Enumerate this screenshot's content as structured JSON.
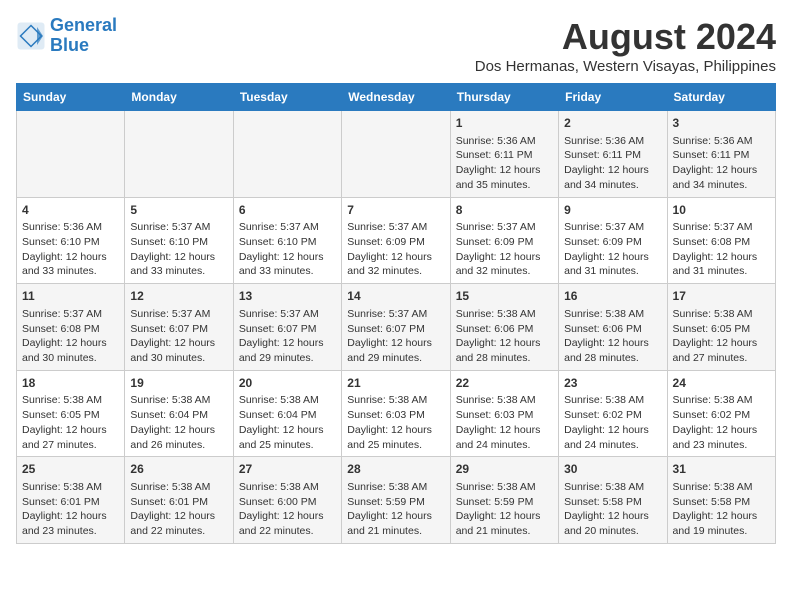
{
  "logo": {
    "line1": "General",
    "line2": "Blue"
  },
  "title": "August 2024",
  "subtitle": "Dos Hermanas, Western Visayas, Philippines",
  "days_header": [
    "Sunday",
    "Monday",
    "Tuesday",
    "Wednesday",
    "Thursday",
    "Friday",
    "Saturday"
  ],
  "weeks": [
    [
      {
        "day": "",
        "content": ""
      },
      {
        "day": "",
        "content": ""
      },
      {
        "day": "",
        "content": ""
      },
      {
        "day": "",
        "content": ""
      },
      {
        "day": "1",
        "content": "Sunrise: 5:36 AM\nSunset: 6:11 PM\nDaylight: 12 hours\nand 35 minutes."
      },
      {
        "day": "2",
        "content": "Sunrise: 5:36 AM\nSunset: 6:11 PM\nDaylight: 12 hours\nand 34 minutes."
      },
      {
        "day": "3",
        "content": "Sunrise: 5:36 AM\nSunset: 6:11 PM\nDaylight: 12 hours\nand 34 minutes."
      }
    ],
    [
      {
        "day": "4",
        "content": "Sunrise: 5:36 AM\nSunset: 6:10 PM\nDaylight: 12 hours\nand 33 minutes."
      },
      {
        "day": "5",
        "content": "Sunrise: 5:37 AM\nSunset: 6:10 PM\nDaylight: 12 hours\nand 33 minutes."
      },
      {
        "day": "6",
        "content": "Sunrise: 5:37 AM\nSunset: 6:10 PM\nDaylight: 12 hours\nand 33 minutes."
      },
      {
        "day": "7",
        "content": "Sunrise: 5:37 AM\nSunset: 6:09 PM\nDaylight: 12 hours\nand 32 minutes."
      },
      {
        "day": "8",
        "content": "Sunrise: 5:37 AM\nSunset: 6:09 PM\nDaylight: 12 hours\nand 32 minutes."
      },
      {
        "day": "9",
        "content": "Sunrise: 5:37 AM\nSunset: 6:09 PM\nDaylight: 12 hours\nand 31 minutes."
      },
      {
        "day": "10",
        "content": "Sunrise: 5:37 AM\nSunset: 6:08 PM\nDaylight: 12 hours\nand 31 minutes."
      }
    ],
    [
      {
        "day": "11",
        "content": "Sunrise: 5:37 AM\nSunset: 6:08 PM\nDaylight: 12 hours\nand 30 minutes."
      },
      {
        "day": "12",
        "content": "Sunrise: 5:37 AM\nSunset: 6:07 PM\nDaylight: 12 hours\nand 30 minutes."
      },
      {
        "day": "13",
        "content": "Sunrise: 5:37 AM\nSunset: 6:07 PM\nDaylight: 12 hours\nand 29 minutes."
      },
      {
        "day": "14",
        "content": "Sunrise: 5:37 AM\nSunset: 6:07 PM\nDaylight: 12 hours\nand 29 minutes."
      },
      {
        "day": "15",
        "content": "Sunrise: 5:38 AM\nSunset: 6:06 PM\nDaylight: 12 hours\nand 28 minutes."
      },
      {
        "day": "16",
        "content": "Sunrise: 5:38 AM\nSunset: 6:06 PM\nDaylight: 12 hours\nand 28 minutes."
      },
      {
        "day": "17",
        "content": "Sunrise: 5:38 AM\nSunset: 6:05 PM\nDaylight: 12 hours\nand 27 minutes."
      }
    ],
    [
      {
        "day": "18",
        "content": "Sunrise: 5:38 AM\nSunset: 6:05 PM\nDaylight: 12 hours\nand 27 minutes."
      },
      {
        "day": "19",
        "content": "Sunrise: 5:38 AM\nSunset: 6:04 PM\nDaylight: 12 hours\nand 26 minutes."
      },
      {
        "day": "20",
        "content": "Sunrise: 5:38 AM\nSunset: 6:04 PM\nDaylight: 12 hours\nand 25 minutes."
      },
      {
        "day": "21",
        "content": "Sunrise: 5:38 AM\nSunset: 6:03 PM\nDaylight: 12 hours\nand 25 minutes."
      },
      {
        "day": "22",
        "content": "Sunrise: 5:38 AM\nSunset: 6:03 PM\nDaylight: 12 hours\nand 24 minutes."
      },
      {
        "day": "23",
        "content": "Sunrise: 5:38 AM\nSunset: 6:02 PM\nDaylight: 12 hours\nand 24 minutes."
      },
      {
        "day": "24",
        "content": "Sunrise: 5:38 AM\nSunset: 6:02 PM\nDaylight: 12 hours\nand 23 minutes."
      }
    ],
    [
      {
        "day": "25",
        "content": "Sunrise: 5:38 AM\nSunset: 6:01 PM\nDaylight: 12 hours\nand 23 minutes."
      },
      {
        "day": "26",
        "content": "Sunrise: 5:38 AM\nSunset: 6:01 PM\nDaylight: 12 hours\nand 22 minutes."
      },
      {
        "day": "27",
        "content": "Sunrise: 5:38 AM\nSunset: 6:00 PM\nDaylight: 12 hours\nand 22 minutes."
      },
      {
        "day": "28",
        "content": "Sunrise: 5:38 AM\nSunset: 5:59 PM\nDaylight: 12 hours\nand 21 minutes."
      },
      {
        "day": "29",
        "content": "Sunrise: 5:38 AM\nSunset: 5:59 PM\nDaylight: 12 hours\nand 21 minutes."
      },
      {
        "day": "30",
        "content": "Sunrise: 5:38 AM\nSunset: 5:58 PM\nDaylight: 12 hours\nand 20 minutes."
      },
      {
        "day": "31",
        "content": "Sunrise: 5:38 AM\nSunset: 5:58 PM\nDaylight: 12 hours\nand 19 minutes."
      }
    ]
  ]
}
